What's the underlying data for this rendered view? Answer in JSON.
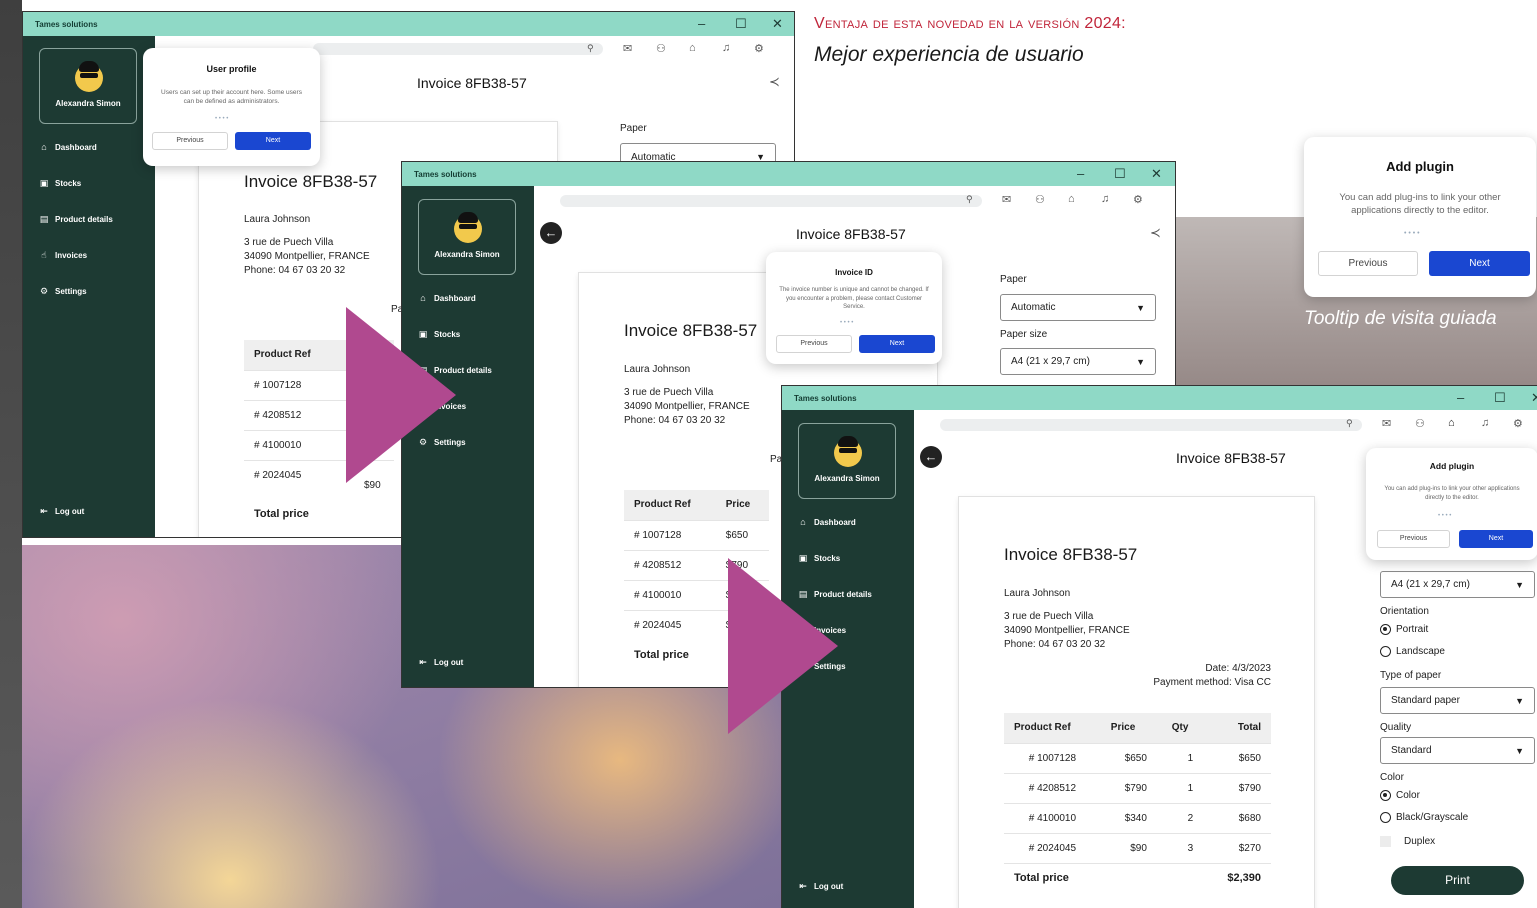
{
  "annotation": {
    "title": "Ventaja de esta novedad en la versión 2024:",
    "subtitle": "Mejor experiencia de usuario",
    "tooltip_caption": "Tooltip de visita guiada"
  },
  "app": {
    "name": "Tames solutions",
    "user": "Alexandra Simon",
    "nav": [
      "Dashboard",
      "Stocks",
      "Product details",
      "Invoices",
      "Settings"
    ],
    "logout": "Log out",
    "nav_icons": [
      "home-icon",
      "box-icon",
      "document-icon",
      "hand-coin-icon",
      "gear-icon"
    ],
    "accent": "#1a47d1",
    "sidebar_color": "#1d3a33",
    "titlebar_color": "#8fd9c6"
  },
  "invoice": {
    "header": "Invoice 8FB38-57",
    "customer": "Laura Johnson",
    "address1": "3 rue de Puech Villa",
    "address2": "34090 Montpellier, FRANCE",
    "phone": "Phone: 04 67 03 20 32",
    "date": "Date: 4/3/2023",
    "payment": "Payment method: Visa CC",
    "columns": [
      "Product Ref",
      "Price",
      "Qty",
      "Total"
    ],
    "rows": [
      [
        "# 1007128",
        "$650",
        "1",
        "$650"
      ],
      [
        "# 4208512",
        "$790",
        "1",
        "$790"
      ],
      [
        "# 4100010",
        "$340",
        "2",
        "$680"
      ],
      [
        "# 2024045",
        "$90",
        "3",
        "$270"
      ]
    ],
    "total_label": "Total price",
    "total_value": "$2,390",
    "partial_label": "Pa",
    "partial_price": "$90"
  },
  "print": {
    "paper_label": "Paper",
    "paper_value": "Automatic",
    "paper_size_label": "Paper size",
    "paper_size_value": "A4 (21 x 29,7 cm)",
    "orientation_label": "Orientation",
    "portrait": "Portrait",
    "landscape": "Landscape",
    "type_label": "Type of paper",
    "type_value": "Standard paper",
    "quality_label": "Quality",
    "quality_value": "Standard",
    "color_label": "Color",
    "color_opt": "Color",
    "bw_opt": "Black/Grayscale",
    "duplex": "Duplex",
    "print_button": "Print"
  },
  "tooltips": {
    "user_profile": {
      "title": "User profile",
      "body": "Users can set up their account here. Some users can be defined as administrators."
    },
    "invoice_id": {
      "title": "Invoice ID",
      "body": "The invoice number is unique and cannot be changed. If you encounter a problem, please contact Customer Service."
    },
    "add_plugin": {
      "title": "Add plugin",
      "body": "You can add plug-ins to link your other applications directly to the editor."
    },
    "previous": "Previous",
    "next": "Next"
  }
}
